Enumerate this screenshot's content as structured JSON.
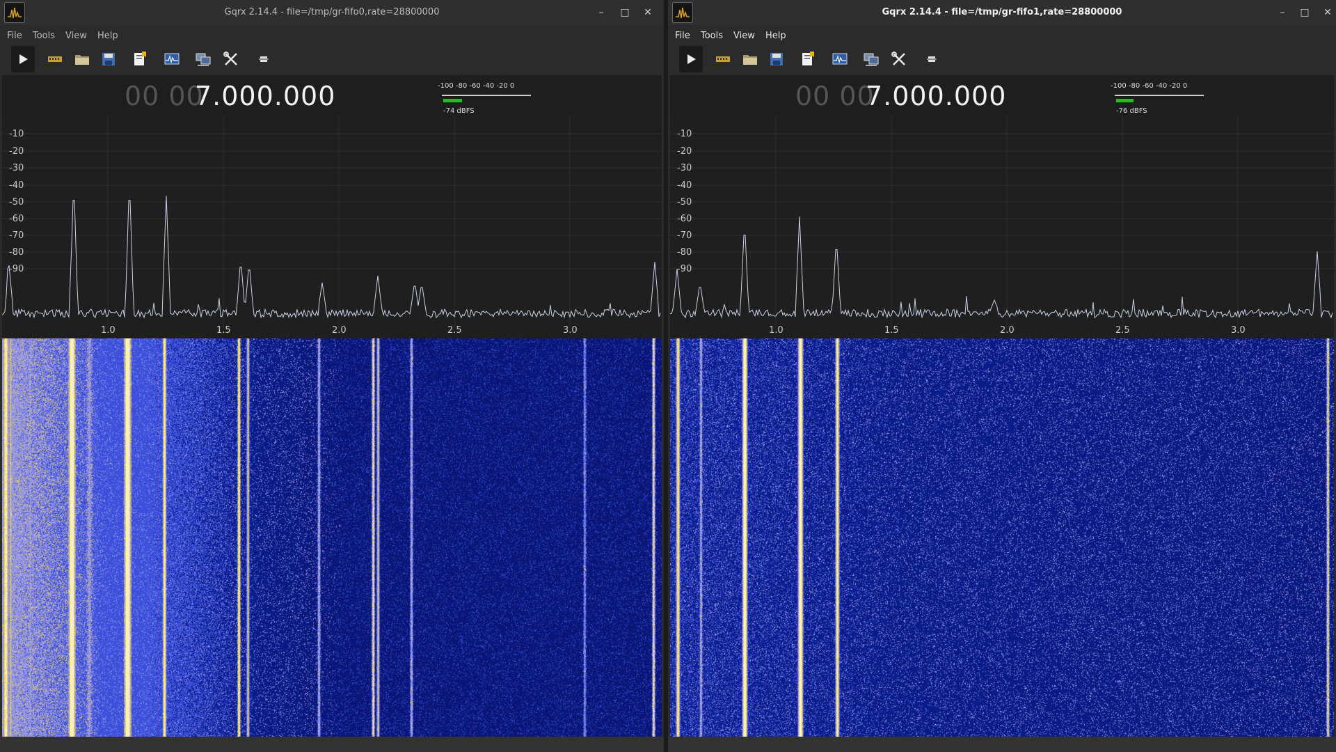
{
  "windows": [
    {
      "title": "Gqrx 2.14.4 - file=/tmp/gr-fifo0,rate=28800000",
      "menu": [
        "File",
        "Tools",
        "View",
        "Help"
      ],
      "frequency": {
        "dim": "00 00",
        "main": "7.000.000"
      },
      "smeter": {
        "scale": "-100  -80  -60  -40  -20   0",
        "reading": "-74 dBFS",
        "level_fraction": 0.22
      },
      "spectrum": {
        "y_ticks": [
          "-10",
          "-20",
          "-30",
          "-40",
          "-50",
          "-60",
          "-70",
          "-80",
          "-90"
        ],
        "x_ticks": [
          "1.0",
          "1.5",
          "2.0",
          "2.5",
          "3.0"
        ]
      }
    },
    {
      "title": "Gqrx 2.14.4 - file=/tmp/gr-fifo1,rate=28800000",
      "menu": [
        "File",
        "Tools",
        "View",
        "Help"
      ],
      "frequency": {
        "dim": "00 00",
        "main": "7.000.000"
      },
      "smeter": {
        "scale": "-100  -80  -60  -40  -20   0",
        "reading": "-76 dBFS",
        "level_fraction": 0.2
      },
      "spectrum": {
        "y_ticks": [
          "-10",
          "-20",
          "-30",
          "-40",
          "-50",
          "-60",
          "-70",
          "-80",
          "-90"
        ],
        "x_ticks": [
          "1.0",
          "1.5",
          "2.0",
          "2.5",
          "3.0"
        ]
      }
    }
  ],
  "toolbar_icons": [
    "play-icon",
    "hardware-icon",
    "open-file-icon",
    "save-icon",
    "bookmark-icon",
    "fft-settings-icon",
    "remote-control-icon",
    "tools-icon",
    "dock-icon"
  ],
  "colors": {
    "plot_trace": "#c8d4e6",
    "waterfall_bg": "#0a1a6a",
    "signal_hot": "#ffe8a0",
    "smeter_bar": "#1fc11f"
  }
}
